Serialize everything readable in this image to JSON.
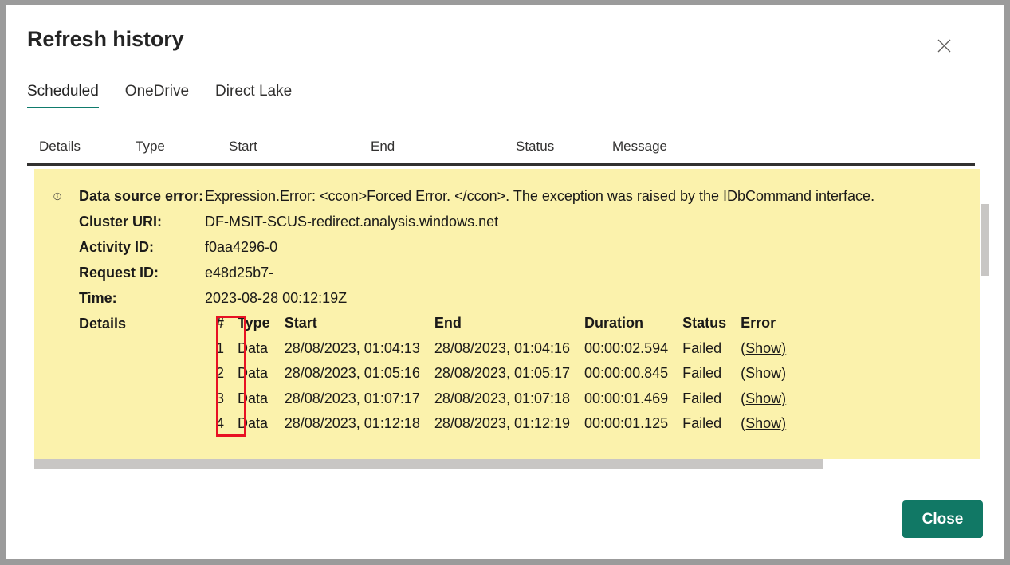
{
  "dialog": {
    "title": "Refresh history",
    "close_icon": "close-icon",
    "close_button_label": "Close",
    "accent_color": "#117865",
    "panel_color": "#fbf2ac",
    "highlight_color": "#e81123"
  },
  "tabs": [
    {
      "label": "Scheduled",
      "active": true
    },
    {
      "label": "OneDrive",
      "active": false
    },
    {
      "label": "Direct Lake",
      "active": false
    }
  ],
  "columns": [
    {
      "label": "Details"
    },
    {
      "label": "Type"
    },
    {
      "label": "Start"
    },
    {
      "label": "End"
    },
    {
      "label": "Status"
    },
    {
      "label": "Message"
    }
  ],
  "error_panel": {
    "info_icon": "info-circle-icon",
    "fields": [
      {
        "label": "Data source error:",
        "value": "Expression.Error: <ccon>Forced Error. </ccon>. The exception was raised by the IDbCommand interface."
      },
      {
        "label": "Cluster URI:",
        "value": "DF-MSIT-SCUS-redirect.analysis.windows.net"
      },
      {
        "label": "Activity ID:",
        "value": "f0aa4296-0"
      },
      {
        "label": "Request ID:",
        "value": "e48d25b7-"
      },
      {
        "label": "Time:",
        "value": "2023-08-28 00:12:19Z"
      }
    ],
    "details_label": "Details",
    "details_table": {
      "headers": [
        "#",
        "Type",
        "Start",
        "End",
        "Duration",
        "Status",
        "Error"
      ],
      "rows": [
        {
          "num": "1",
          "type": "Data",
          "start": "28/08/2023, 01:04:13",
          "end": "28/08/2023, 01:04:16",
          "duration": "00:00:02.594",
          "status": "Failed",
          "error": "(Show)"
        },
        {
          "num": "2",
          "type": "Data",
          "start": "28/08/2023, 01:05:16",
          "end": "28/08/2023, 01:05:17",
          "duration": "00:00:00.845",
          "status": "Failed",
          "error": "(Show)"
        },
        {
          "num": "3",
          "type": "Data",
          "start": "28/08/2023, 01:07:17",
          "end": "28/08/2023, 01:07:18",
          "duration": "00:00:01.469",
          "status": "Failed",
          "error": "(Show)"
        },
        {
          "num": "4",
          "type": "Data",
          "start": "28/08/2023, 01:12:18",
          "end": "28/08/2023, 01:12:19",
          "duration": "00:00:01.125",
          "status": "Failed",
          "error": "(Show)"
        }
      ]
    }
  }
}
